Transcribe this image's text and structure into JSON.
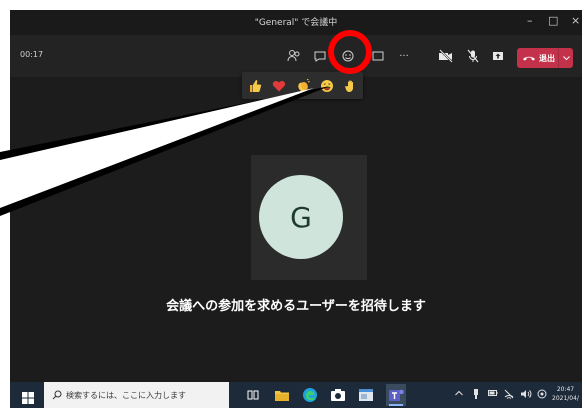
{
  "window": {
    "title": "\"General\" で会議中",
    "minimize": "–",
    "maximize": "□",
    "close": "×"
  },
  "toolbar": {
    "timer": "00:17",
    "leave_label": "退出",
    "more_label": "···"
  },
  "reactions": [
    "thumbs-up",
    "heart",
    "clap",
    "laugh",
    "raise-hand"
  ],
  "main": {
    "avatar_initial": "G",
    "invite_message": "会議への参加を求めるユーザーを招待します"
  },
  "taskbar": {
    "search_placeholder": "検索するには、ここに入力します",
    "clock_time": "20:47",
    "clock_date": "2021/04/"
  },
  "colors": {
    "leave": "#c4314b",
    "highlight_circle": "#ff0000",
    "avatar_bg": "#cfe4da",
    "window_bg": "#1c1c1c"
  }
}
